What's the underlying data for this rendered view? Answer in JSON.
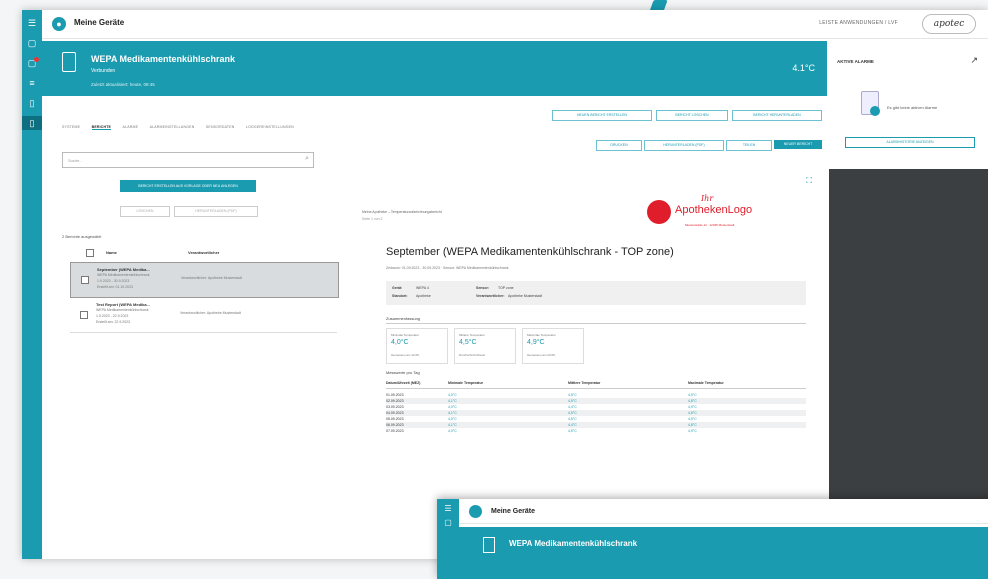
{
  "app": {
    "title": "Meine Geräte",
    "user": "LEISTE ANWENDUNGEN / LVF",
    "logo": "apotec"
  },
  "rail": {
    "icons": [
      "menu-icon",
      "tablet-icon",
      "alarm-icon",
      "list-icon",
      "file-icon",
      "device-icon"
    ]
  },
  "device": {
    "name": "WEPA Medikamentenkühlschrank",
    "status": "Verbunden",
    "subtitle": "Zuletzt aktualisiert: heute, 08:45",
    "temp": "4.1°C"
  },
  "alarm": {
    "heading": "AKTIVE ALARME",
    "message": "Es gibt keine aktiven Alarme",
    "button": "ALARMHISTORIE ANZEIGEN"
  },
  "tabs": [
    "SYSTEME",
    "BERICHTE",
    "ALARME",
    "ALARMEINSTELLUNGEN",
    "SENSORDATEN",
    "LOGGEREINSTELLUNGEN"
  ],
  "top_buttons": [
    "NEUEN BERICHT ERSTELLEN",
    "BERICHT LÖSCHEN",
    "BERICHT HERUNTERLADEN"
  ],
  "action_buttons": [
    "DRUCKEN",
    "HERUNTERLADEN (PDF)",
    "TEILEN",
    "NEUER BERICHT"
  ],
  "search": {
    "placeholder": "Suche..."
  },
  "list": {
    "create_button": "BERICHT ERSTELLEN AUS VORLAGE ODER NEU ANLEGEN",
    "secondary_buttons": [
      "LÖSCHEN",
      "HERUNTERLADEN (PDF)"
    ],
    "count": "2 Berichte ausgewählt",
    "headers": [
      "Name",
      "Verantwortlicher"
    ],
    "items": [
      {
        "title": "September (WEPA Medika...",
        "line1": "WEPA Medikamentenkühlschrank",
        "line2": "1.9.2023 - 30.9.2023",
        "line3": "Erstellt am: 01.10.2023",
        "right": "Verantwortlicher: Apotheke Musterstadt"
      },
      {
        "title": "Test Report (WEPA Medika...",
        "line1": "WEPA Medikamentenkühlschrank",
        "line2": "1.9.2023 - 22.9.2023",
        "line3": "Erstellt am: 22.9.2023",
        "right": "Verantwortlicher: Apotheke Musterstadt"
      }
    ]
  },
  "report": {
    "meta": "Meine Apotheke – Temperaturaufzeichnungsbericht",
    "meta2": "Seite 1 von 2",
    "logo_small": "Ihr",
    "logo_big": "ApothekenLogo",
    "logo_address": "Musterstraße 12 · 12345 Musterstadt",
    "title": "September (WEPA Medikamentenkühlschrank - TOP zone)",
    "subtitle": "Zeitraum: 01.09.2023 - 30.09.2023 · Sensor: WEPA Medikamentenkühlschrank",
    "info": {
      "k1": "Gerät:",
      "v1": "WEPA 4",
      "k2": "Standort:",
      "v2": "Apotheke",
      "k3": "Sensor:",
      "v3": "TOP zone",
      "k4": "Verantwortlicher:",
      "v4": "Apotheke Musterstadt"
    },
    "sect1": "Zusammenfassung",
    "cards": [
      {
        "label": "Minimale Temperatur",
        "value": "4,0°C",
        "foot": "Gemessen am 12.09."
      },
      {
        "label": "Mittlere Temperatur",
        "value": "4,5°C",
        "foot": "Durchschnitt Monat"
      },
      {
        "label": "Maximale Temperatur",
        "value": "4,9°C",
        "foot": "Gemessen am 23.09."
      }
    ],
    "sect2": "Messwerte pro Tag",
    "table": {
      "headers": [
        "Datum/Uhrzeit (MEZ)",
        "Minimale Temperatur",
        "Mittlere Temperatur",
        "Maximale Temperatur"
      ],
      "rows": [
        [
          "01.09.2023",
          "4,0°C",
          "4,5°C",
          "4,9°C"
        ],
        [
          "02.09.2023",
          "4,1°C",
          "4,5°C",
          "4,8°C"
        ],
        [
          "03.09.2023",
          "4,0°C",
          "4,4°C",
          "4,9°C"
        ],
        [
          "04.09.2023",
          "4,1°C",
          "4,5°C",
          "4,8°C"
        ],
        [
          "05.09.2023",
          "4,0°C",
          "4,5°C",
          "4,9°C"
        ],
        [
          "06.09.2023",
          "4,1°C",
          "4,4°C",
          "4,8°C"
        ],
        [
          "07.09.2023",
          "4,0°C",
          "4,5°C",
          "4,9°C"
        ]
      ]
    }
  },
  "second_window": {
    "title": "Meine Geräte",
    "device": "WEPA Medikamentenkühlschrank"
  }
}
